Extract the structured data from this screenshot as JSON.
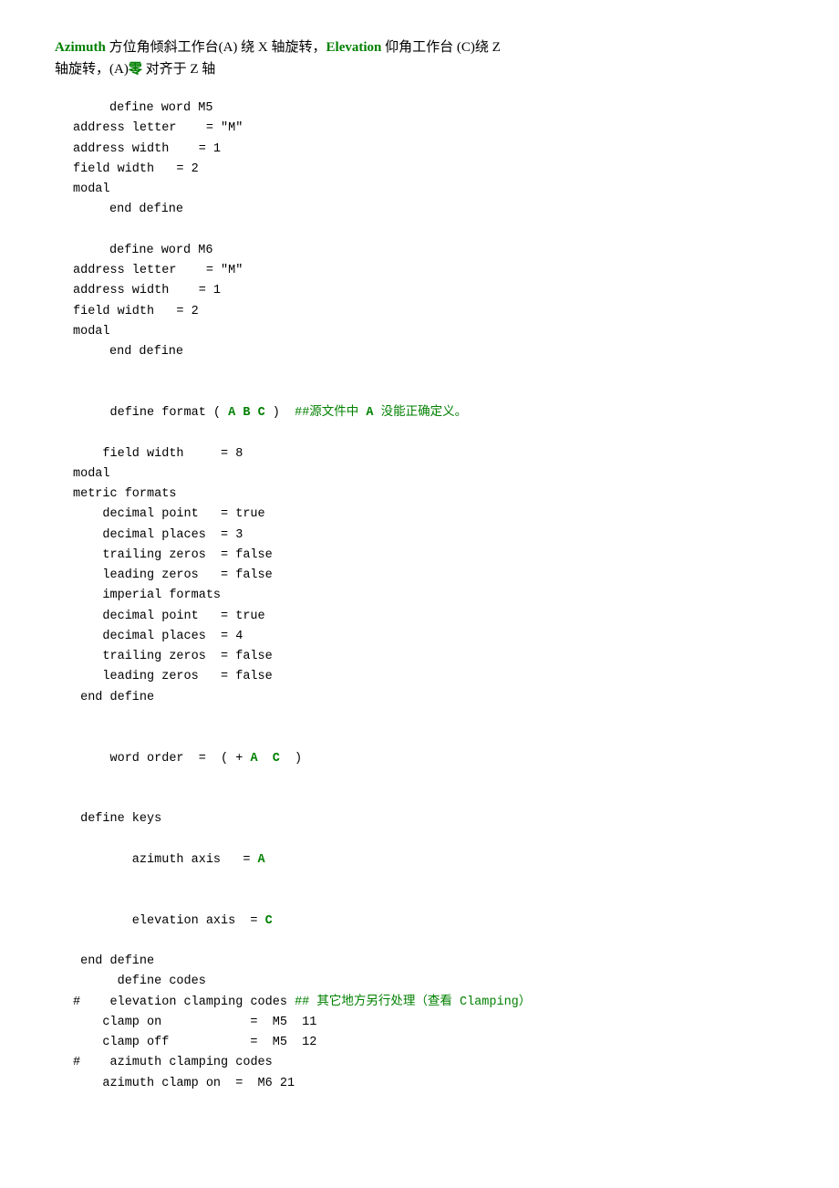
{
  "intro": {
    "line1_prefix": "Azimuth",
    "line1_azimuth": "Azimuth",
    "line1_mid": " 方位角倾斜工作台(A) 绕 X 轴旋转，",
    "line1_elevation": "Elevation",
    "line1_end": " 仰角工作台 (C)绕 Z",
    "line2": "轴旋转，(A)",
    "line2_ling": "零",
    "line2_end": " 对齐于 Z 轴"
  },
  "code": {
    "define_m5_label": "define word M5",
    "address_letter_m5": "address letter    = \"M\"",
    "address_width_m5": "address width    = 1",
    "field_width_m5": "field width   = 2",
    "modal_m5": "modal",
    "end_define_m5": "end define",
    "define_m6_label": "define word M6",
    "address_letter_m6": "address letter    = \"M\"",
    "address_width_m6": "address width    = 1",
    "field_width_m6": "field width   = 2",
    "modal_m6": "modal",
    "end_define_m6": "end define",
    "define_format_label": "define format ( A B C )",
    "define_format_comment": "  ##源文件中 A 没能正确定义。",
    "field_width_format": "field width     = 8",
    "modal_format": "modal",
    "metric_formats": "metric formats",
    "decimal_point_metric": "decimal point   = true",
    "decimal_places_metric": "decimal places  = 3",
    "trailing_zeros_metric": "trailing zeros  = false",
    "leading_zeros_metric": "leading zeros   = false",
    "imperial_formats": "imperial formats",
    "decimal_point_imperial": "decimal point   = true",
    "decimal_places_imperial": "decimal places  = 4",
    "trailing_zeros_imperial": "trailing zeros  = false",
    "leading_zeros_imperial": "leading zeros   = false",
    "end_define_format": "end define",
    "word_order": "word order  =  ( + A  C  )",
    "define_keys": "define keys",
    "azimuth_axis": "azimuth axis   = A",
    "elevation_axis": "elevation axis  = C",
    "end_define_keys": "end define",
    "define_codes": "define codes",
    "hash1": "#",
    "elevation_clamping": "   elevation clamping codes ##  其它地方另行处理（查看 Clamping）",
    "clamp_on": "clamp on            =  M5  11",
    "clamp_off": "clamp off           =  M5  12",
    "hash2": "#",
    "azimuth_clamping": "   azimuth clamping codes",
    "azimuth_clamp_on": "azimuth clamp on  =  M6 21"
  }
}
